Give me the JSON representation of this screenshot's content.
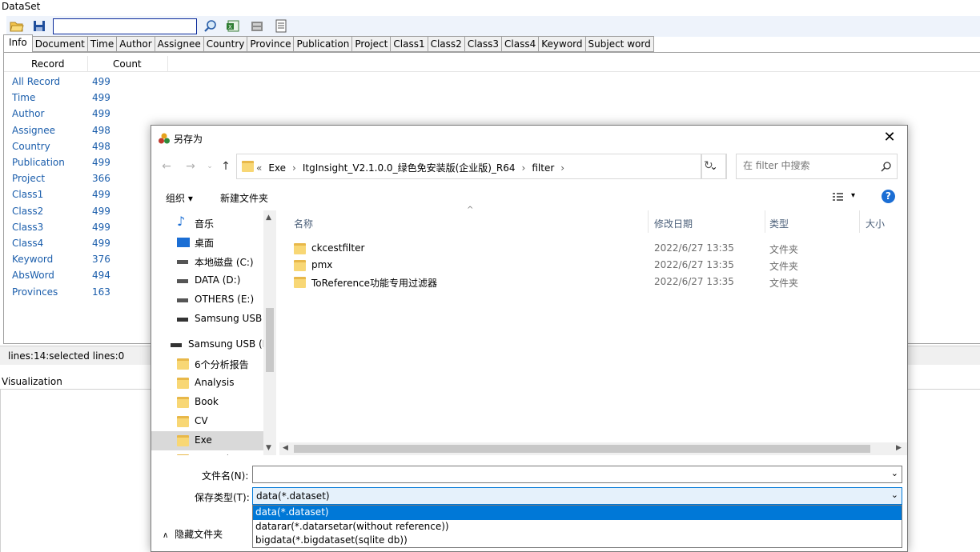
{
  "app": {
    "dataset_title": "DataSet",
    "visualization_title": "Visualization",
    "status": "lines:14:selected lines:0",
    "search_value": "",
    "tabs": [
      "Info",
      "Document",
      "Time",
      "Author",
      "Assignee",
      "Country",
      "Province",
      "Publication",
      "Project",
      "Class1",
      "Class2",
      "Class3",
      "Class4",
      "Keyword",
      "Subject word"
    ],
    "list_headers": {
      "record": "Record",
      "count": "Count"
    },
    "rows": [
      {
        "name": "All Record",
        "count": "499"
      },
      {
        "name": "Time",
        "count": "499"
      },
      {
        "name": "Author",
        "count": "499"
      },
      {
        "name": "Assignee",
        "count": "498"
      },
      {
        "name": "Country",
        "count": "498"
      },
      {
        "name": "Publication",
        "count": "499"
      },
      {
        "name": "Project",
        "count": "366"
      },
      {
        "name": "Class1",
        "count": "499"
      },
      {
        "name": "Class2",
        "count": "499"
      },
      {
        "name": "Class3",
        "count": "499"
      },
      {
        "name": "Class4",
        "count": "499"
      },
      {
        "name": "Keyword",
        "count": "376"
      },
      {
        "name": "AbsWord",
        "count": "494"
      },
      {
        "name": "Provinces",
        "count": "163"
      }
    ]
  },
  "dialog": {
    "title": "另存为",
    "close": "✕",
    "breadcrumbs": [
      "«",
      "Exe",
      "›",
      "ItgInsight_V2.1.0.0_绿色免安装版(企业版)_R64",
      "›",
      "filter",
      "›"
    ],
    "search_placeholder": "在 filter 中搜索",
    "organize": "组织 ▾",
    "new_folder": "新建文件夹",
    "help": "?",
    "nav_items": [
      {
        "label": "音乐",
        "icon": "music-icon"
      },
      {
        "label": "桌面",
        "icon": "desktop-icon"
      },
      {
        "label": "本地磁盘 (C:)",
        "icon": "drive-icon"
      },
      {
        "label": "DATA (D:)",
        "icon": "drive-icon"
      },
      {
        "label": "OTHERS (E:)",
        "icon": "drive-icon"
      },
      {
        "label": "Samsung USB",
        "icon": "usb-icon"
      },
      {
        "label": "Samsung USB (F",
        "icon": "usb-icon"
      },
      {
        "label": "6个分析报告",
        "icon": "folder-icon"
      },
      {
        "label": "Analysis",
        "icon": "folder-icon"
      },
      {
        "label": "Book",
        "icon": "folder-icon"
      },
      {
        "label": "CV",
        "icon": "folder-icon"
      },
      {
        "label": "Exe",
        "icon": "folder-icon"
      },
      {
        "label": "Forensic",
        "icon": "folder-icon"
      }
    ],
    "columns": {
      "name": "名称",
      "date": "修改日期",
      "type": "类型",
      "size": "大小"
    },
    "files": [
      {
        "name": "ckcestfilter",
        "date": "2022/6/27 13:35",
        "type": "文件夹"
      },
      {
        "name": "pmx",
        "date": "2022/6/27 13:35",
        "type": "文件夹"
      },
      {
        "name": "ToReference功能专用过滤器",
        "date": "2022/6/27 13:35",
        "type": "文件夹"
      }
    ],
    "filename_label": "文件名(N):",
    "filename_value": "",
    "filetype_label": "保存类型(T):",
    "filetype_value": "data(*.dataset)",
    "filetype_options": [
      "data(*.dataset)",
      "datarar(*.datarsetar(without reference))",
      "bigdata(*.bigdataset(sqlite db))"
    ],
    "hide_folders": "隐藏文件夹"
  }
}
